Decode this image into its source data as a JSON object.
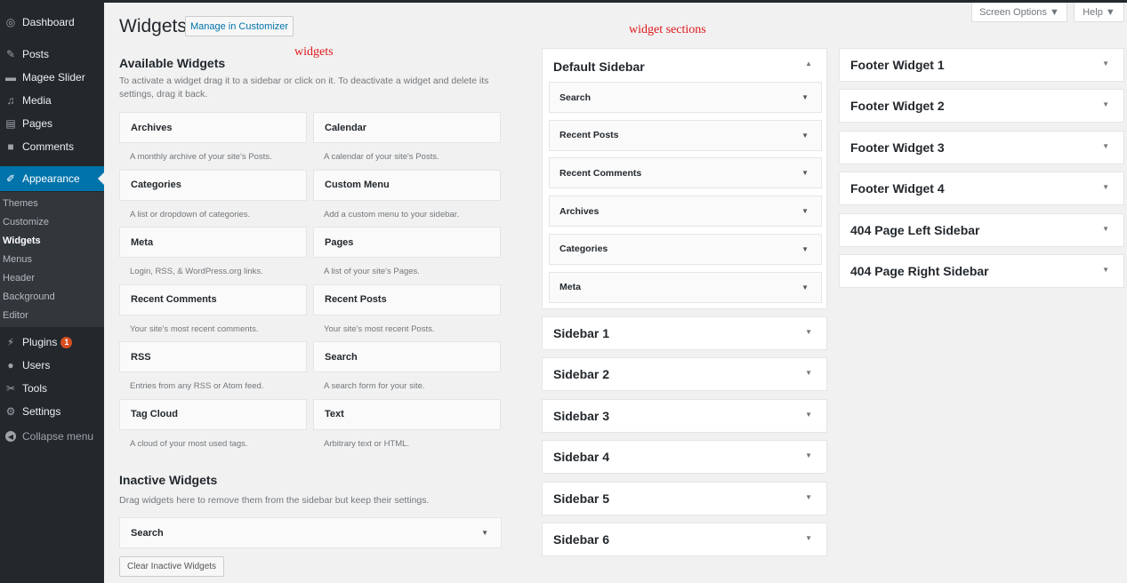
{
  "menu": {
    "dashboard": "Dashboard",
    "posts": "Posts",
    "slider": "Magee Slider",
    "media": "Media",
    "pages": "Pages",
    "comments": "Comments",
    "appearance": "Appearance",
    "plugins": "Plugins",
    "plugins_badge": "1",
    "users": "Users",
    "tools": "Tools",
    "settings": "Settings",
    "collapse": "Collapse menu",
    "submenu": [
      "Themes",
      "Customize",
      "Widgets",
      "Menus",
      "Header",
      "Background",
      "Editor"
    ]
  },
  "header": {
    "title": "Widgets",
    "manage_button": "Manage in Customizer",
    "screen_options": "Screen Options ▼",
    "help": "Help ▼"
  },
  "annotations": {
    "widgets": "widgets",
    "sections": "widget sections"
  },
  "available": {
    "heading": "Available Widgets",
    "description": "To activate a widget drag it to a sidebar or click on it. To deactivate a widget and delete its settings, drag it back.",
    "widgets": [
      {
        "name": "Archives",
        "desc": "A monthly archive of your site's Posts."
      },
      {
        "name": "Calendar",
        "desc": "A calendar of your site's Posts."
      },
      {
        "name": "Categories",
        "desc": "A list or dropdown of categories."
      },
      {
        "name": "Custom Menu",
        "desc": "Add a custom menu to your sidebar."
      },
      {
        "name": "Meta",
        "desc": "Login, RSS, & WordPress.org links."
      },
      {
        "name": "Pages",
        "desc": "A list of your site's Pages."
      },
      {
        "name": "Recent Comments",
        "desc": "Your site's most recent comments."
      },
      {
        "name": "Recent Posts",
        "desc": "Your site's most recent Posts."
      },
      {
        "name": "RSS",
        "desc": "Entries from any RSS or Atom feed."
      },
      {
        "name": "Search",
        "desc": "A search form for your site."
      },
      {
        "name": "Tag Cloud",
        "desc": "A cloud of your most used tags."
      },
      {
        "name": "Text",
        "desc": "Arbitrary text or HTML."
      }
    ]
  },
  "inactive": {
    "heading": "Inactive Widgets",
    "description": "Drag widgets here to remove them from the sidebar but keep their settings.",
    "widget": "Search",
    "clear_button": "Clear Inactive Widgets"
  },
  "sidebars": {
    "default": {
      "title": "Default Sidebar",
      "widgets": [
        "Search",
        "Recent Posts",
        "Recent Comments",
        "Archives",
        "Categories",
        "Meta"
      ]
    },
    "column2": [
      "Sidebar 1",
      "Sidebar 2",
      "Sidebar 3",
      "Sidebar 4",
      "Sidebar 5",
      "Sidebar 6"
    ],
    "column3": [
      "Footer Widget 1",
      "Footer Widget 2",
      "Footer Widget 3",
      "Footer Widget 4",
      "404 Page Left Sidebar",
      "404 Page Right Sidebar"
    ]
  },
  "icons": {
    "caret_down": "▼",
    "caret_up": "▲"
  }
}
